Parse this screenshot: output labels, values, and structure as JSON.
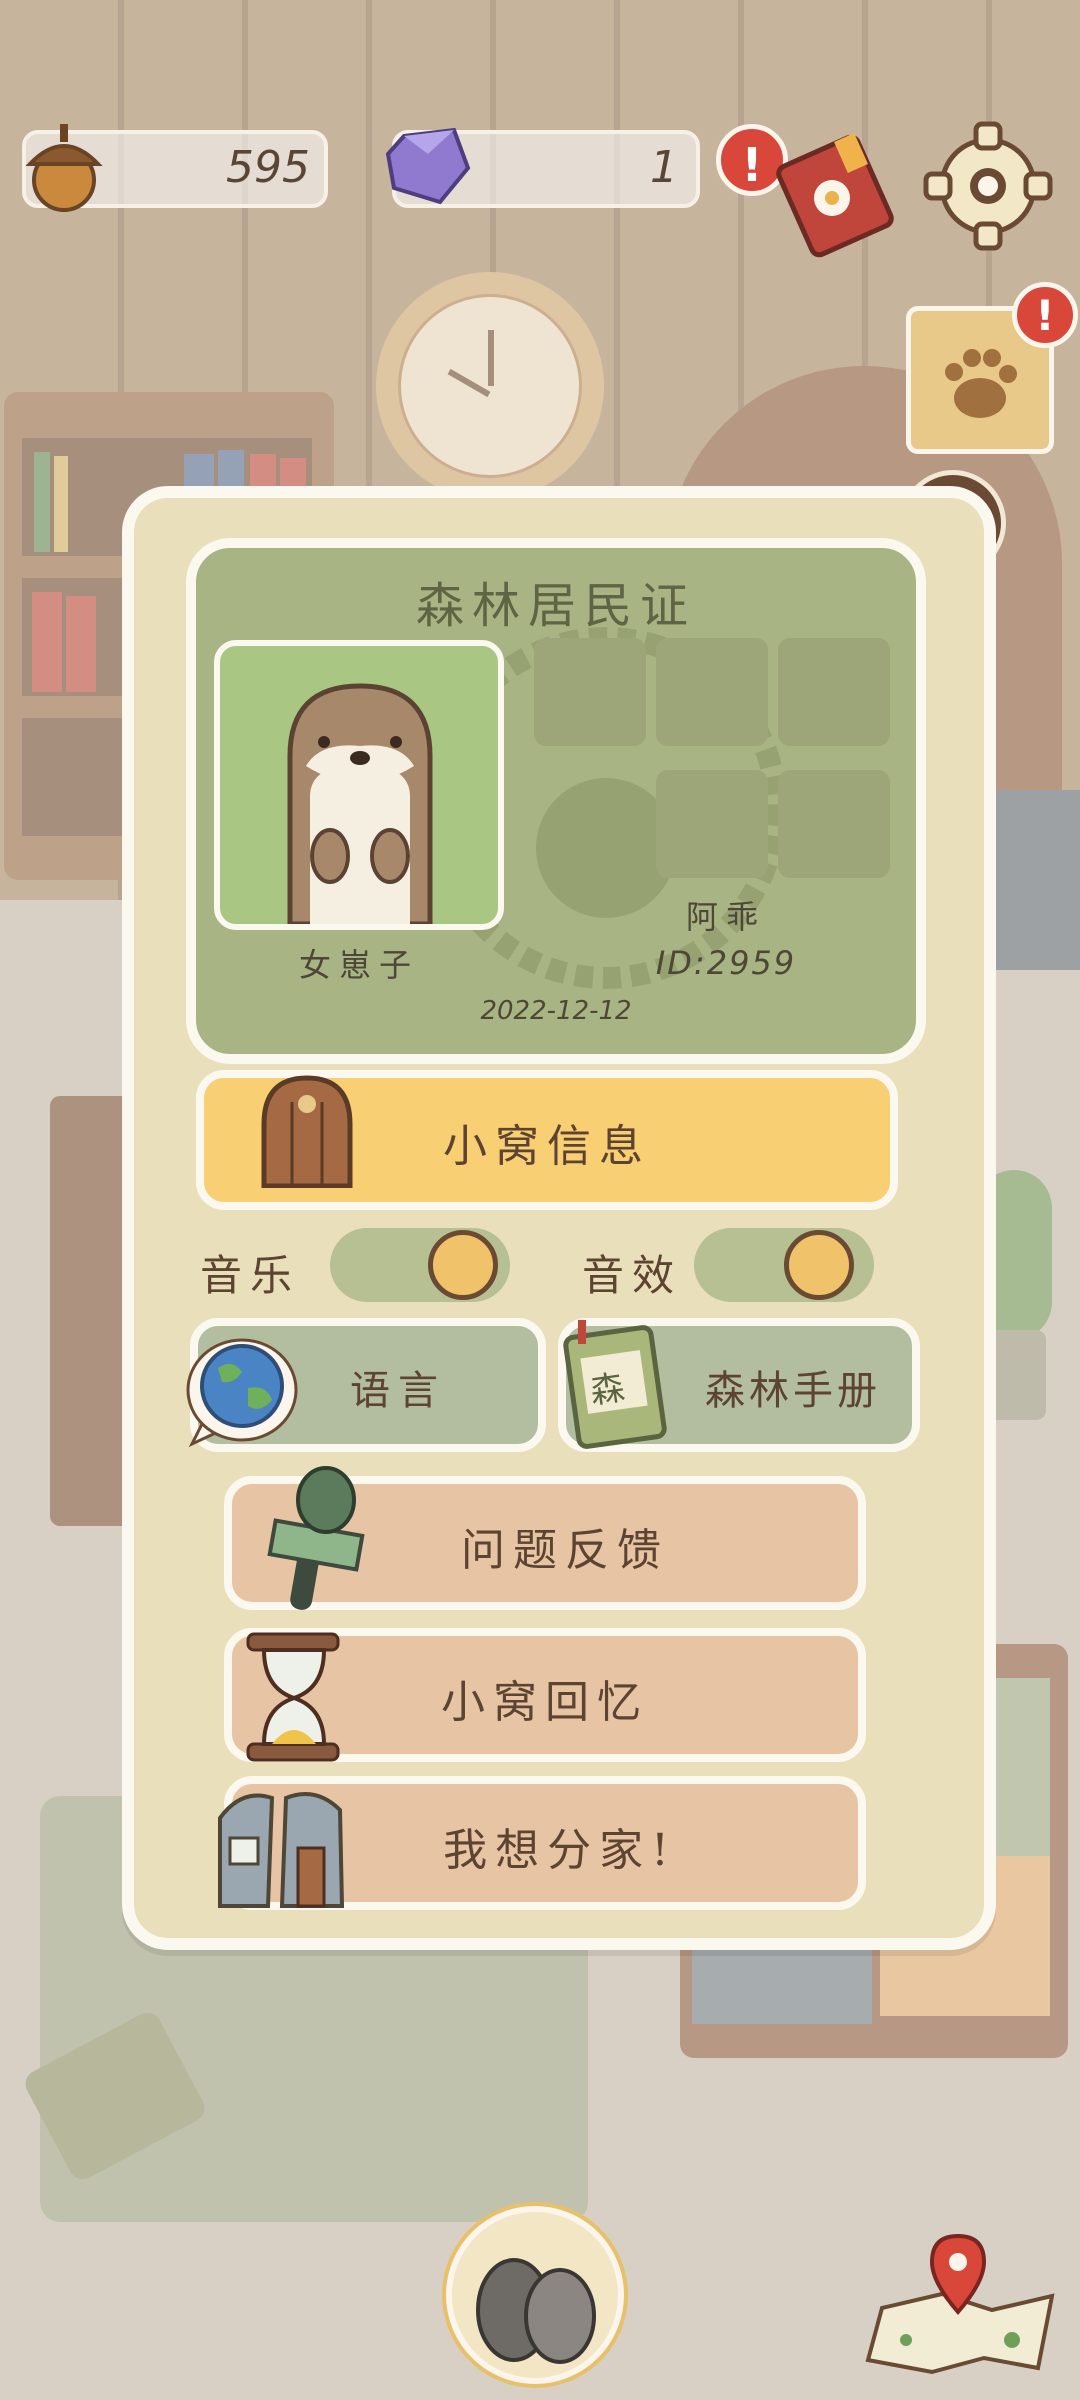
{
  "hud": {
    "acorn_count": "595",
    "gem_count": "1",
    "alert_mark": "!"
  },
  "id_card": {
    "title": "森林居民证",
    "gender": "女崽子",
    "name": "阿乖",
    "id": "ID:2959",
    "date": "2022-12-12"
  },
  "menu": {
    "home_info": "小窝信息",
    "music_label": "音乐",
    "sfx_label": "音效",
    "language": "语言",
    "forest_handbook": "森林手册",
    "feedback": "问题反馈",
    "home_memories": "小窝回忆",
    "move_out": "我想分家!"
  },
  "book_stamp": "森",
  "colors": {
    "card_bg": "#e9dfba",
    "id_panel": "#a8b483",
    "home_info_btn": "#f8cf72",
    "green_btn": "#b3bea0",
    "peach_btn": "#e7c5a4",
    "alert_red": "#d9473a"
  }
}
